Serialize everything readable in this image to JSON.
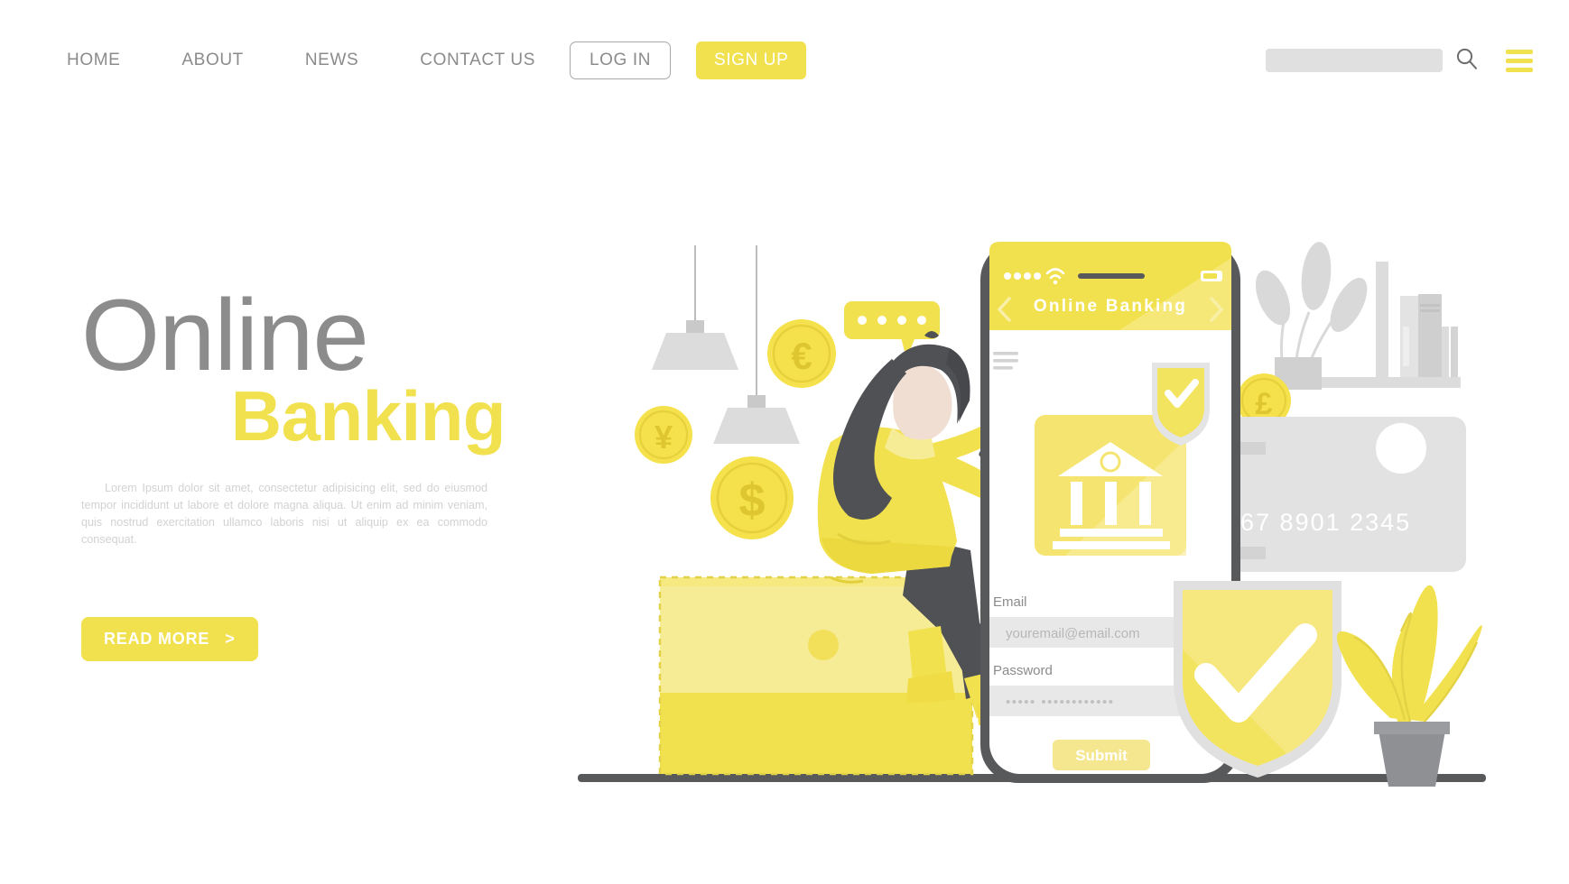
{
  "nav": {
    "links": [
      {
        "label": "HOME",
        "name": "nav-link-home"
      },
      {
        "label": "ABOUT",
        "name": "nav-link-about"
      },
      {
        "label": "NEWS",
        "name": "nav-link-news"
      },
      {
        "label": "CONTACT US",
        "name": "nav-link-contact-us"
      }
    ],
    "login_label": "LOG IN",
    "signup_label": "SIGN UP",
    "search_placeholder": "",
    "search_value": "",
    "search_icon": "search-icon",
    "menu_icon": "hamburger-menu-icon"
  },
  "hero": {
    "title_line1": "Online",
    "title_line2": "Banking",
    "paragraph": "Lorem Ipsum dolor sit amet, consectetur adipisicing elit, sed do eiusmod tempor incididunt ut labore et dolore magna aliqua. Ut enim ad minim veniam, quis nostrud exercitation ullamco laboris nisi ut aliquip ex ea commodo consequat.",
    "cta_label": "READ MORE",
    "cta_arrow": ">"
  },
  "phone": {
    "app_title": "Online Banking",
    "back_icon": "chevron-left-icon",
    "forward_icon": "chevron-right-icon",
    "wifi_icon": "wifi-icon",
    "battery_icon": "battery-icon",
    "menu_icon": "hamburger-menu-icon",
    "signal_dots": 4,
    "card_icon": "bank-building-icon",
    "form": {
      "email_label": "Email",
      "email_placeholder": "youremail@email.com",
      "password_label": "Password",
      "password_value": "•••••  ••••••••••••",
      "submit_label": "Submit"
    }
  },
  "scene": {
    "credit_card_number": "567 8901 2345",
    "coins": [
      {
        "symbol": "€",
        "name": "coin-euro"
      },
      {
        "symbol": "¥",
        "name": "coin-yen"
      },
      {
        "symbol": "$",
        "name": "coin-dollar"
      },
      {
        "symbol": "£",
        "name": "coin-pound"
      }
    ],
    "chat_bubble_dots": 4,
    "shield_icon": "shield-check-icon",
    "small_shield_icon": "shield-check-icon",
    "wallet_icon": "wallet-icon",
    "plant_icon": "potted-plant-icon",
    "lamp_icon": "pendant-lamp-icon",
    "books_icon": "bookshelf-icon"
  },
  "colors": {
    "yellow": "#f2e14f",
    "yellow_light": "#f7eb8a",
    "yellow_pale": "#faf3b8",
    "gray_text": "#8b8b8b",
    "gray_light": "#e0e0e0",
    "gray_dark": "#53565a",
    "white": "#ffffff"
  }
}
